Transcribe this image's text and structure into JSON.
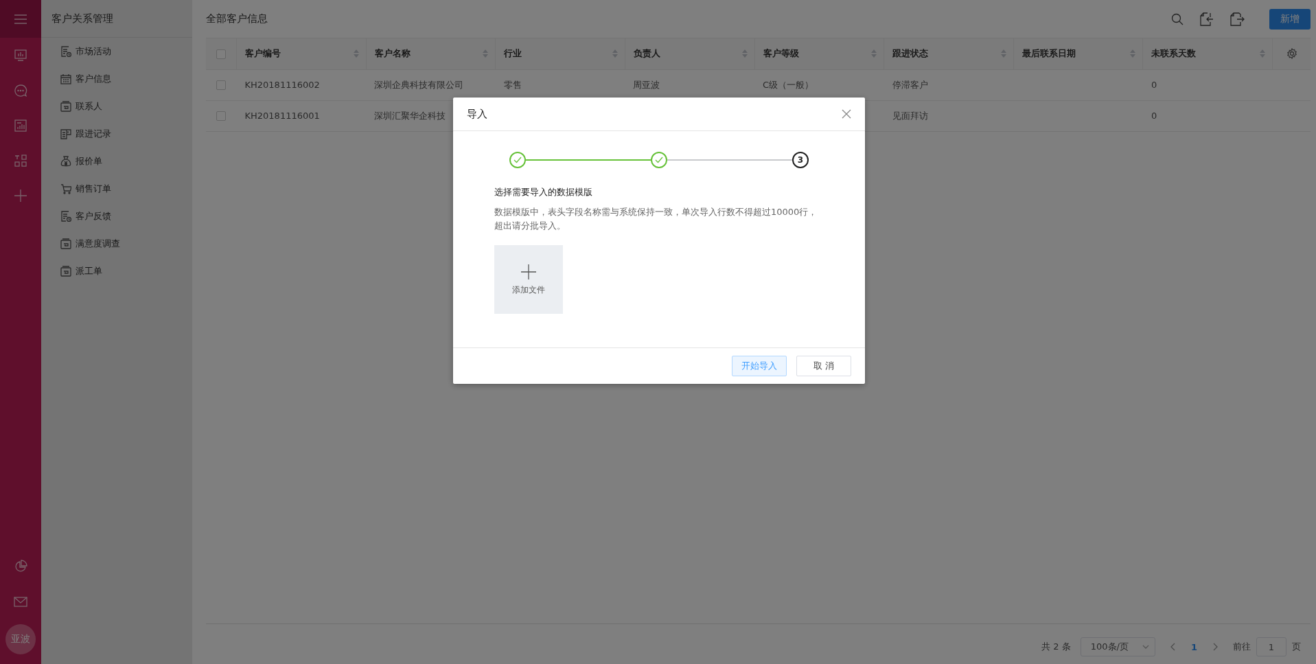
{
  "rail": {
    "avatar": "亚波"
  },
  "sidebar": {
    "title": "客户关系管理",
    "items": [
      {
        "label": "市场活动",
        "kind": "document"
      },
      {
        "label": "客户信息",
        "kind": "calendar"
      },
      {
        "label": "联系人",
        "kind": "folder"
      },
      {
        "label": "跟进记录",
        "kind": "board"
      },
      {
        "label": "报价单",
        "kind": "money"
      },
      {
        "label": "销售订单",
        "kind": "cart"
      },
      {
        "label": "客户反馈",
        "kind": "document"
      },
      {
        "label": "满意度调查",
        "kind": "folder"
      },
      {
        "label": "派工单",
        "kind": "folder"
      }
    ]
  },
  "header": {
    "title": "全部客户信息",
    "new_button": "新增"
  },
  "table": {
    "all_checked": false,
    "columns": [
      {
        "label": "客户编号",
        "sortable": true
      },
      {
        "label": "客户名称",
        "sortable": true
      },
      {
        "label": "行业",
        "sortable": true
      },
      {
        "label": "负责人",
        "sortable": true
      },
      {
        "label": "客户等级",
        "sortable": true
      },
      {
        "label": "跟进状态",
        "sortable": true
      },
      {
        "label": "最后联系日期",
        "sortable": true
      },
      {
        "label": "未联系天数",
        "sortable": true
      }
    ],
    "rows": [
      {
        "checked": false,
        "cells": {
          "customer_no": "KH20181116002",
          "customer_name": "深圳企典科技有限公司",
          "industry": "零售",
          "owner": "周亚波",
          "grade": "C级（一般）",
          "follow_status": "停滞客户",
          "days_without_contact": "0"
        }
      },
      {
        "checked": false,
        "cells": {
          "customer_no": "KH20181116001",
          "customer_name": "深圳汇聚华企科技",
          "follow_status": "见面拜访",
          "days_without_contact": "0"
        }
      }
    ]
  },
  "pagination": {
    "total": "共 2 条",
    "page_size": "100条/页",
    "pages": [
      {
        "label": "1",
        "selected": true
      }
    ],
    "goto_label": "前往",
    "goto_value": "1",
    "goto_suffix": "页"
  },
  "dialog": {
    "title": "导入",
    "steps": [
      {
        "completed": true
      },
      {
        "completed": true
      },
      {
        "label": "3",
        "completed": false
      }
    ],
    "heading": "选择需要导入的数据模版",
    "description": "数据模版中，表头字段名称需与系统保持一致，单次导入行数不得超过10000行，超出请分批导入。",
    "upload_label": "添加文件",
    "buttons": [
      {
        "label": "开始导入",
        "kind": "primary"
      },
      {
        "label": "取 消",
        "kind": "default"
      }
    ]
  }
}
